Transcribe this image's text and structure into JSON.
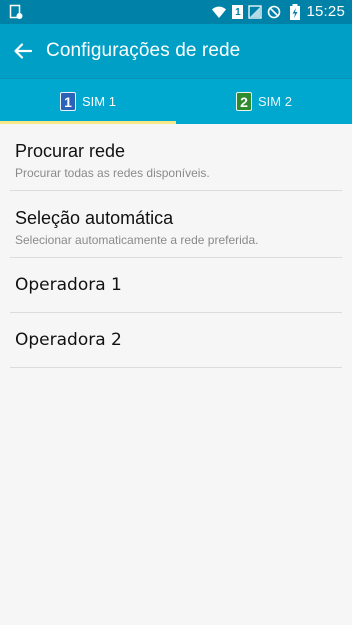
{
  "status_bar": {
    "time": "15:25",
    "icons": [
      "notification-icon",
      "wifi-icon",
      "sim1-icon",
      "no-signal-icon",
      "do-not-disturb-icon",
      "battery-charging-icon"
    ],
    "sim_indicator": "1"
  },
  "action_bar": {
    "title": "Configurações de rede",
    "back_icon": "arrow-left-icon"
  },
  "tabs": [
    {
      "badge": "1",
      "label": "SIM 1",
      "badge_color": "#2a63b8",
      "active": true
    },
    {
      "badge": "2",
      "label": "SIM 2",
      "badge_color": "#2e8b2e",
      "active": false
    }
  ],
  "list": {
    "items": [
      {
        "title": "Procurar rede",
        "subtitle": "Procurar todas as redes disponíveis."
      },
      {
        "title": "Seleção automática",
        "subtitle": "Selecionar automaticamente a rede preferida."
      },
      {
        "title": "Operadora 1"
      },
      {
        "title": "Operadora 2"
      }
    ]
  },
  "colors": {
    "status_bar": "#0082a8",
    "action_bar": "#009fc6",
    "tab_bar": "#00a8d0",
    "tab_indicator": "#f5e98a",
    "background": "#f6f6f6"
  }
}
